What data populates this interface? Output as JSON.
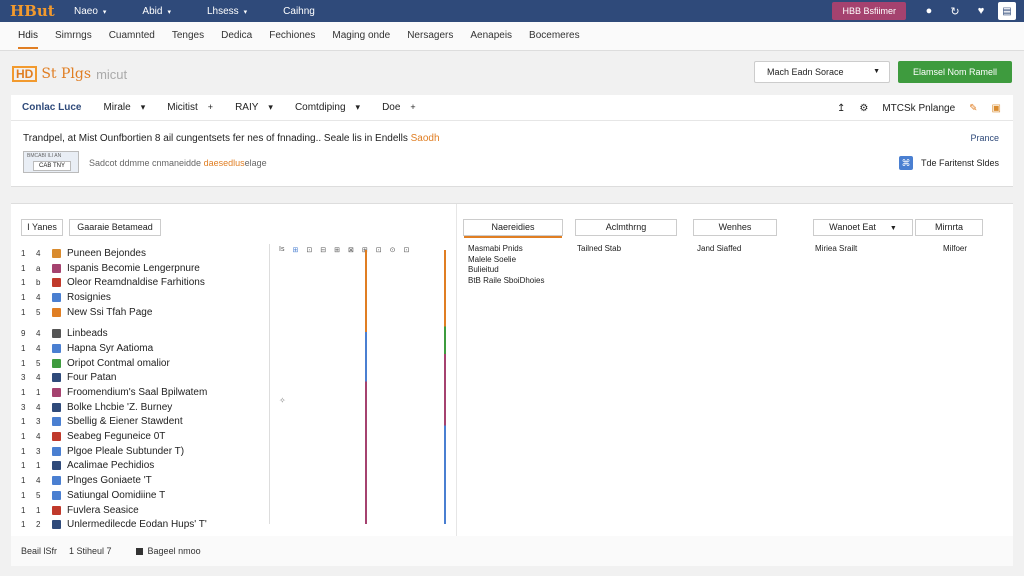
{
  "topbar": {
    "logo": "HBut",
    "nav": [
      {
        "label": "Naeo",
        "caret": "▾"
      },
      {
        "label": "Abid",
        "caret": "▾"
      },
      {
        "label": "Lhsess",
        "caret": "▾"
      },
      {
        "label": "Caihng",
        "caret": ""
      }
    ],
    "button": "HBB Bsfiimer",
    "icons": [
      "circle-icon",
      "refresh-icon",
      "heart-icon",
      "document-icon"
    ]
  },
  "tabs": [
    "Hdis",
    "Simrngs",
    "Cuamnted",
    "Tenges",
    "Dedica",
    "Fechiones",
    "Maging onde",
    "Nersagers",
    "Aenapeis",
    "Bocemeres"
  ],
  "page": {
    "badge": "HD",
    "title": "St Plgs",
    "subtitle": "micut",
    "dropdown": "Mach Eadn Sorace",
    "primary_button": "Elamsel Nom Ramell"
  },
  "toolbar": {
    "items": [
      {
        "label": "Conlac Luce",
        "sym": ""
      },
      {
        "label": "Mirale",
        "sym": "▾"
      },
      {
        "label": "Micitist",
        "sym": "+"
      },
      {
        "label": "RAIY",
        "sym": "▾"
      },
      {
        "label": "Comtdiping",
        "sym": "▾"
      },
      {
        "label": "Doe",
        "sym": "+"
      }
    ],
    "right": [
      "↥",
      "⚙",
      "MTCSk Pnlange"
    ]
  },
  "info": {
    "headline": "Trandpel, at Mist Ounfbortien 8 ail cungentsets fer nes of fnnading.. Seale lis in Endells",
    "headline_highlight": "Saodh",
    "link": "Prance",
    "thumb_top": "BMCABI ILI AN",
    "thumb_label": "CAB TNY",
    "subline": "Sadcot ddmme cnmaneidde",
    "subline_highlight": "daesedlus",
    "subline_end": "elage",
    "side": "Tde Faritenst Sldes"
  },
  "panel": {
    "tabs": [
      "I Yanes",
      "Gaaraie Betamead"
    ],
    "columns": [
      "Naereidies",
      "Aclmthrng",
      "Wenhes",
      "Wanoet Eat",
      "Mirnrta"
    ],
    "icon_labels": [
      "Is",
      "⊞",
      "⊡",
      "⊟",
      "⊞",
      "⊠",
      "⊞",
      "⊡",
      "⊙",
      "⊡"
    ],
    "rows": [
      {
        "n1": "1",
        "n2": "4",
        "color": "#d98b2e",
        "label": "Puneen Bejondes"
      },
      {
        "n1": "1",
        "n2": "a",
        "color": "#a5426f",
        "label": "Ispanis Becomie Lengerpnure"
      },
      {
        "n1": "1",
        "n2": "b",
        "color": "#c0392b",
        "label": "Oleor Reamdnaldise Farhitions"
      },
      {
        "n1": "1",
        "n2": "4",
        "color": "#4a7fd1",
        "label": "Rosignies"
      },
      {
        "n1": "1",
        "n2": "5",
        "color": "#e07e23",
        "label": "New Ssi Tfah Page"
      },
      {
        "n1": "9",
        "n2": "4",
        "color": "#555555",
        "label": "Linbeads",
        "gap": true
      },
      {
        "n1": "1",
        "n2": "4",
        "color": "#4a7fd1",
        "label": "Hapna Syr Aatioma"
      },
      {
        "n1": "1",
        "n2": "5",
        "color": "#3e9b3e",
        "label": "Oripot Contmal omalior"
      },
      {
        "n1": "3",
        "n2": "4",
        "color": "#2f4a7a",
        "label": "Four Patan"
      },
      {
        "n1": "1",
        "n2": "1",
        "color": "#a5426f",
        "label": "Froomendium's Saal Bpilwatem"
      },
      {
        "n1": "3",
        "n2": "4",
        "color": "#2f4a7a",
        "label": "Bolke Lhcbie 'Z. Burney"
      },
      {
        "n1": "1",
        "n2": "3",
        "color": "#4a7fd1",
        "label": "Sbellig & Eiener Stawdent"
      },
      {
        "n1": "1",
        "n2": "4",
        "color": "#c0392b",
        "label": "Seabeg Feguneice 0T"
      },
      {
        "n1": "1",
        "n2": "3",
        "color": "#4a7fd1",
        "label": "Plgoe Pleale Subtunder T)"
      },
      {
        "n1": "1",
        "n2": "1",
        "color": "#2f4a7a",
        "label": "Acalimae Pechidios"
      },
      {
        "n1": "1",
        "n2": "4",
        "color": "#4a7fd1",
        "label": "Plnges Goniaete 'T"
      },
      {
        "n1": "1",
        "n2": "5",
        "color": "#4a7fd1",
        "label": "Satiungal Oomidiine T"
      },
      {
        "n1": "1",
        "n2": "1",
        "color": "#c0392b",
        "label": "Fuvlera Seasice"
      },
      {
        "n1": "1",
        "n2": "2",
        "color": "#2f4a7a",
        "label": "Unlermedilecde Eodan Hups' T'"
      }
    ],
    "details": [
      "Masmabi Pnids",
      "Malele Soelie",
      "Bulieitud",
      "BtB Raile SboiDhoies"
    ],
    "cells": [
      "Tailned Stab",
      "Jand Siaffed",
      "Miriea Srailt",
      "Milfoer"
    ],
    "dot": "✧"
  },
  "footer": {
    "left": "Beail lSfr",
    "mid": "1 Stiheul 7",
    "right": "Bageel nmoo"
  }
}
